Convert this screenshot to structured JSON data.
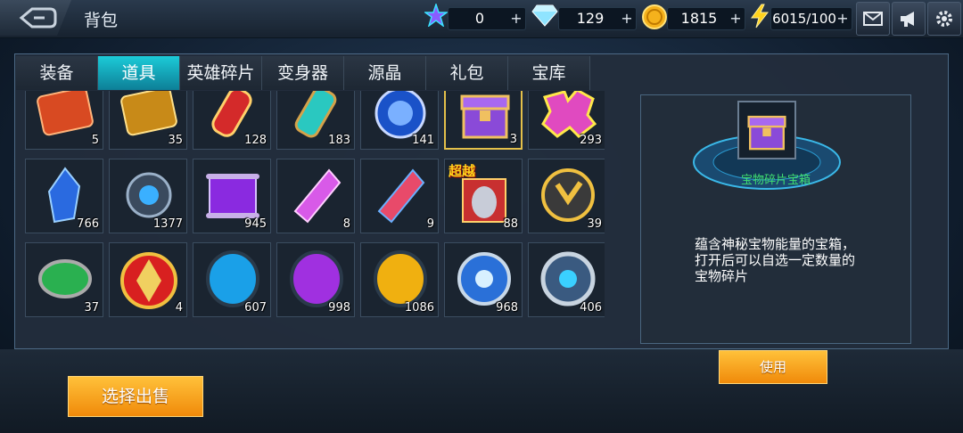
{
  "header": {
    "title": "背包",
    "resources": [
      {
        "icon": "star-crystal-icon",
        "value": "0"
      },
      {
        "icon": "diamond-icon",
        "value": "129"
      },
      {
        "icon": "gold-coin-icon",
        "value": "1815"
      },
      {
        "icon": "lightning-icon",
        "value": "6015/100"
      }
    ],
    "plus": "+",
    "buttons": [
      "mail-icon",
      "announcement-icon",
      "settings-icon"
    ]
  },
  "tabs": [
    {
      "label": "装备",
      "active": false
    },
    {
      "label": "道具",
      "active": true
    },
    {
      "label": "英雄碎片",
      "active": false
    },
    {
      "label": "变身器",
      "active": false
    },
    {
      "label": "源晶",
      "active": false
    },
    {
      "label": "礼包",
      "active": false
    },
    {
      "label": "宝库",
      "active": false
    }
  ],
  "items": [
    {
      "icon": "exp-ticket-red-icon",
      "count": "5"
    },
    {
      "icon": "exp-ticket-gold-icon",
      "count": "35"
    },
    {
      "icon": "red-canister-icon",
      "count": "128"
    },
    {
      "icon": "energy-capsule-icon",
      "count": "183"
    },
    {
      "icon": "blue-emblem-icon",
      "count": "141"
    },
    {
      "icon": "treasure-chest-icon",
      "count": "3",
      "selected": true
    },
    {
      "icon": "rainbow-puzzle-icon",
      "count": "293"
    },
    {
      "icon": "blue-crystal-icon",
      "count": "766"
    },
    {
      "icon": "orb-device-icon",
      "count": "1377"
    },
    {
      "icon": "purple-scroll-icon",
      "count": "945"
    },
    {
      "icon": "pink-crystal-icon",
      "count": "8"
    },
    {
      "icon": "fire-crystal-icon",
      "count": "9"
    },
    {
      "icon": "hero-head-icon",
      "count": "88",
      "tag": "超越"
    },
    {
      "icon": "gold-ring-icon",
      "count": "39"
    },
    {
      "icon": "green-gem-icon",
      "count": "37"
    },
    {
      "icon": "red-medallion-icon",
      "count": "4"
    },
    {
      "icon": "cyan-gem-icon",
      "count": "607"
    },
    {
      "icon": "purple-gem-icon",
      "count": "998"
    },
    {
      "icon": "yellow-gem-icon",
      "count": "1086"
    },
    {
      "icon": "blue-orb-icon",
      "count": "968"
    },
    {
      "icon": "silver-core-icon",
      "count": "406"
    }
  ],
  "detail": {
    "icon": "treasure-chest-icon",
    "name": "宝物碎片宝箱",
    "description": "蕴含神秘宝物能量的宝箱，打开后可以自选一定数量的宝物碎片",
    "use_label": "使用"
  },
  "sell_label": "选择出售",
  "colors": {
    "accent_tab": "#16b8cc",
    "button_orange": "#f5a01a",
    "selected_border": "#e4c04a",
    "item_name": "#40e070"
  }
}
